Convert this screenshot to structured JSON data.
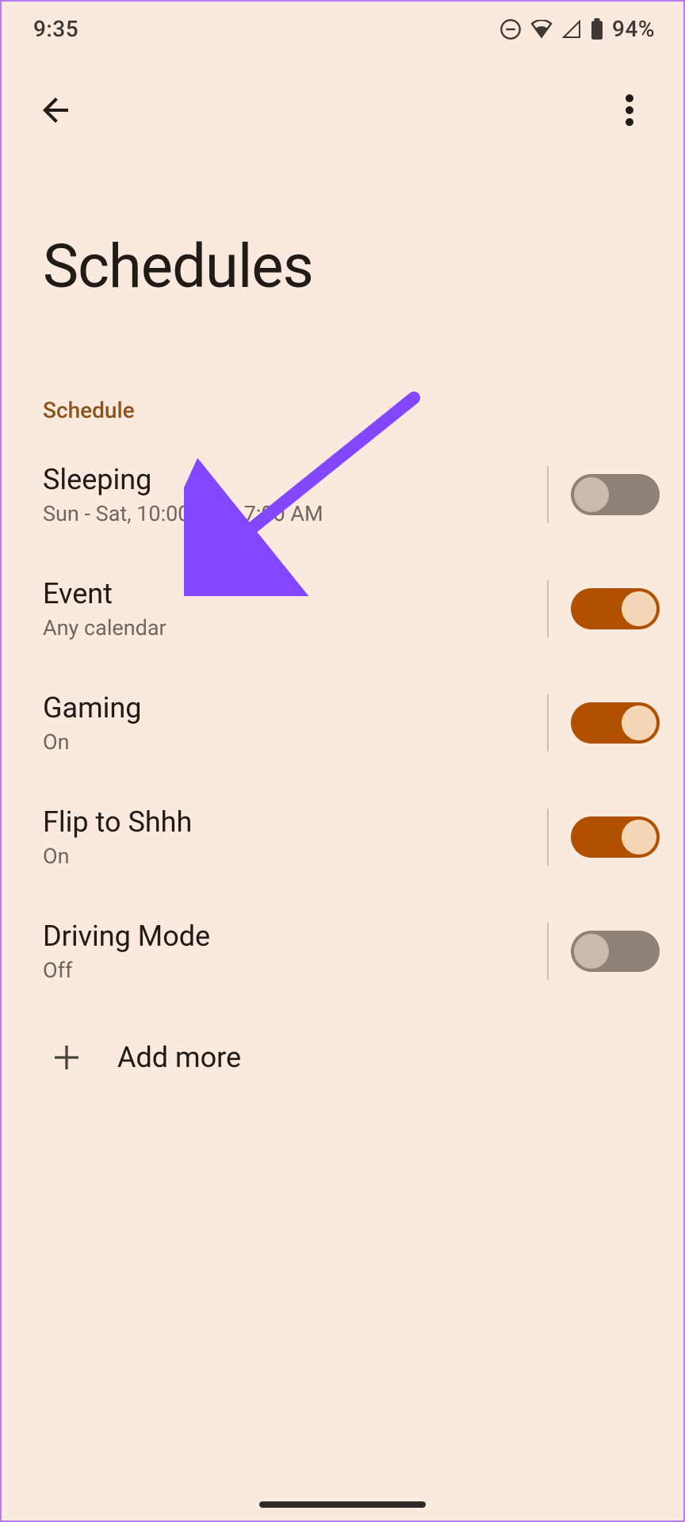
{
  "status": {
    "time": "9:35",
    "battery_pct": "94%"
  },
  "page": {
    "title": "Schedules",
    "section_label": "Schedule",
    "add_more_label": "Add more"
  },
  "schedules": [
    {
      "title": "Sleeping",
      "subtitle": "Sun - Sat, 10:00 PM - 7:00 AM",
      "enabled": false
    },
    {
      "title": "Event",
      "subtitle": "Any calendar",
      "enabled": true
    },
    {
      "title": "Gaming",
      "subtitle": "On",
      "enabled": true
    },
    {
      "title": "Flip to Shhh",
      "subtitle": "On",
      "enabled": true
    },
    {
      "title": "Driving Mode",
      "subtitle": "Off",
      "enabled": false
    }
  ]
}
